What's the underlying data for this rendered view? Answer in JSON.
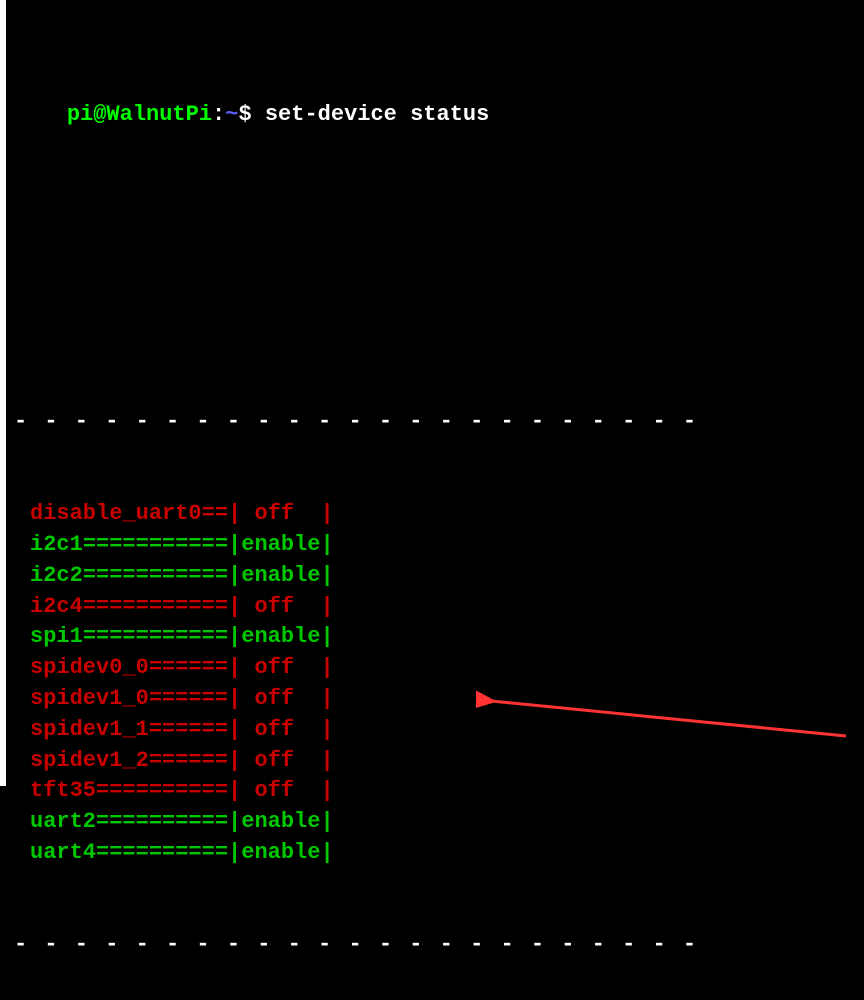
{
  "prompt": {
    "user": "pi@WalnutPi",
    "colon": ":",
    "path": "~",
    "dollar": "$",
    "command": "set-device status"
  },
  "separator": "- - - - - - - - - - - - - - - - - - - - - - -",
  "rows": [
    {
      "name": "disable_uart0",
      "filler": "==",
      "status": " off  ",
      "enabled": false
    },
    {
      "name": "i2c1",
      "filler": "===========",
      "status": "enable",
      "enabled": true
    },
    {
      "name": "i2c2",
      "filler": "===========",
      "status": "enable",
      "enabled": true
    },
    {
      "name": "i2c4",
      "filler": "===========",
      "status": " off  ",
      "enabled": false
    },
    {
      "name": "spi1",
      "filler": "===========",
      "status": "enable",
      "enabled": true
    },
    {
      "name": "spidev0_0",
      "filler": "======",
      "status": " off  ",
      "enabled": false
    },
    {
      "name": "spidev1_0",
      "filler": "======",
      "status": " off  ",
      "enabled": false
    },
    {
      "name": "spidev1_1",
      "filler": "======",
      "status": " off  ",
      "enabled": false
    },
    {
      "name": "spidev1_2",
      "filler": "======",
      "status": " off  ",
      "enabled": false
    },
    {
      "name": "tft35",
      "filler": "==========",
      "status": " off  ",
      "enabled": false
    },
    {
      "name": "uart2",
      "filler": "==========",
      "status": "enable",
      "enabled": true
    },
    {
      "name": "uart4",
      "filler": "==========",
      "status": "enable",
      "enabled": true
    }
  ]
}
